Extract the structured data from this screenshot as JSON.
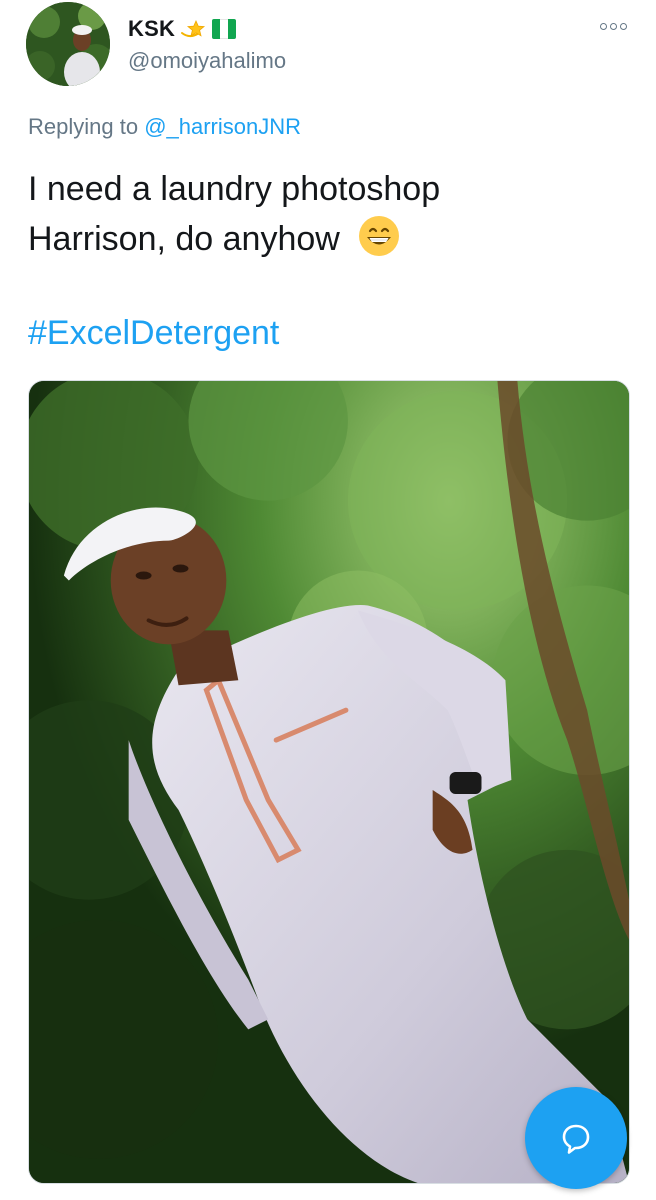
{
  "tweet": {
    "author": {
      "display_name": "KSK",
      "name_emoji": "dizzy-star-icon",
      "flag": "nigeria-flag-icon",
      "handle": "@omoiyahalimo",
      "avatar_icon": "profile-avatar"
    },
    "more_icon": "more-options-icon",
    "replying_to_prefix": "Replying to ",
    "replying_to_user": "@_harrisonJNR",
    "text_line1": "I need a laundry photoshop",
    "text_line2": "Harrison, do anyhow",
    "text_emoji": "grinning-face-icon",
    "hashtag": "#ExcelDetergent",
    "media": {
      "kind": "photo",
      "icon": "tweet-photo"
    }
  },
  "fab": {
    "icon": "compose-reply-icon"
  },
  "colors": {
    "link": "#1da1f2",
    "secondary_text": "#657786",
    "primary_text": "#14171a",
    "fab_background": "#1da1f2",
    "flag_green": "#11a650"
  }
}
